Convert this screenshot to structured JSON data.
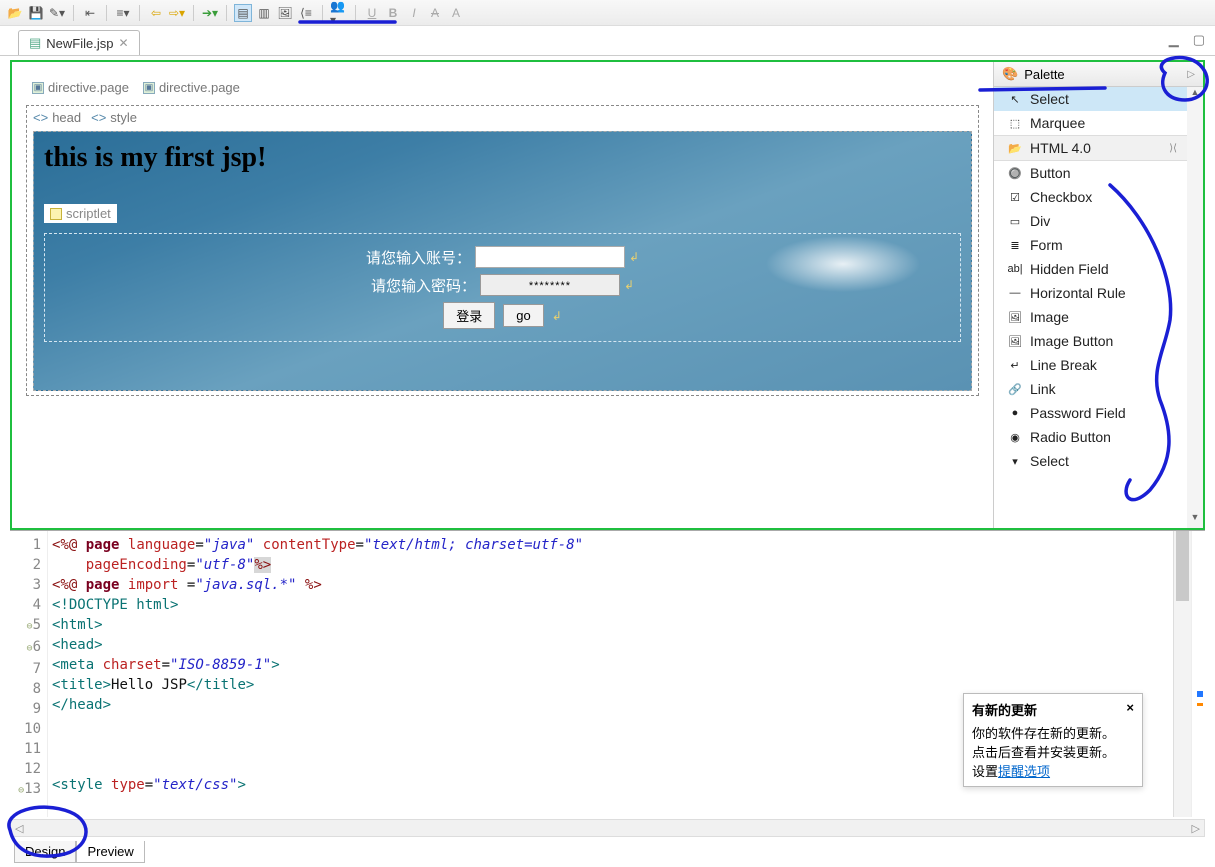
{
  "toolbar": {
    "icons": [
      "open-folder",
      "save",
      "wand",
      "sep",
      "outdent",
      "sep",
      "align",
      "sep",
      "back",
      "fwd",
      "sep",
      "next",
      "sep",
      "split-h",
      "split-v",
      "image",
      "code",
      "sep",
      "people",
      "sep",
      "underline",
      "bold",
      "italic",
      "strike",
      "font"
    ]
  },
  "tab": {
    "filename": "NewFile.jsp",
    "close": "✕"
  },
  "design": {
    "directive1": "directive.page",
    "directive2": "directive.page",
    "head": "head",
    "style": "style",
    "title": "this is my first jsp!",
    "scriptlet": "scriptlet",
    "label_account": "请您输入账号：",
    "label_password": "请您输入密码：",
    "pwd_placeholder": "********",
    "btn_login": "登录",
    "btn_go": "go"
  },
  "palette": {
    "title": "Palette",
    "items_top": [
      {
        "icon": "cursor",
        "label": "Select",
        "sel": true
      },
      {
        "icon": "marquee",
        "label": "Marquee"
      }
    ],
    "group": "HTML 4.0",
    "items": [
      {
        "icon": "btn",
        "label": "Button"
      },
      {
        "icon": "chk",
        "label": "Checkbox"
      },
      {
        "icon": "div",
        "label": "Div"
      },
      {
        "icon": "form",
        "label": "Form"
      },
      {
        "icon": "hid",
        "label": "Hidden Field"
      },
      {
        "icon": "hr",
        "label": "Horizontal Rule"
      },
      {
        "icon": "img",
        "label": "Image"
      },
      {
        "icon": "imgb",
        "label": "Image Button"
      },
      {
        "icon": "br",
        "label": "Line Break"
      },
      {
        "icon": "link",
        "label": "Link"
      },
      {
        "icon": "pwd",
        "label": "Password Field"
      },
      {
        "icon": "radio",
        "label": "Radio Button"
      },
      {
        "icon": "sel",
        "label": "Select"
      }
    ]
  },
  "code": {
    "lines": [
      {
        "n": "1",
        "fold": "",
        "html": "<span class='c-dir'>&lt;%@</span> <span class='c-kw'>page</span> <span class='c-attr'>language</span>=<span class='c-str'>\"java\"</span> <span class='c-attr'>contentType</span>=<span class='c-str'>\"text/html; charset=utf-8\"</span>"
      },
      {
        "n": "2",
        "fold": "",
        "html": "    <span class='c-attr'>pageEncoding</span>=<span class='c-str'>\"utf-8\"</span><span class='sel'><span class='c-dir'>%&gt;</span></span>"
      },
      {
        "n": "3",
        "fold": "",
        "html": "<span class='c-dir'>&lt;%@</span> <span class='c-kw'>page</span> <span class='c-attr'>import</span> =<span class='c-str'>\"java.sql.*\"</span> <span class='c-dir'>%&gt;</span>"
      },
      {
        "n": "4",
        "fold": "",
        "html": "<span class='c-tag'>&lt;!DOCTYPE html&gt;</span>"
      },
      {
        "n": "5",
        "fold": "⊖",
        "html": "<span class='c-tag'>&lt;html&gt;</span>"
      },
      {
        "n": "6",
        "fold": "⊖",
        "html": "<span class='c-tag'>&lt;head&gt;</span>"
      },
      {
        "n": "7",
        "fold": "",
        "html": "<span class='c-tag'>&lt;meta</span> <span class='c-attr'>charset</span>=<span class='c-str'>\"ISO-8859-1\"</span><span class='c-tag'>&gt;</span>"
      },
      {
        "n": "8",
        "fold": "",
        "html": "<span class='c-tag'>&lt;title&gt;</span>Hello JSP<span class='c-tag'>&lt;/title&gt;</span>"
      },
      {
        "n": "9",
        "fold": "",
        "html": "<span class='c-tag'>&lt;/head&gt;</span>"
      },
      {
        "n": "10",
        "fold": "",
        "html": ""
      },
      {
        "n": "11",
        "fold": "",
        "html": ""
      },
      {
        "n": "12",
        "fold": "",
        "html": ""
      },
      {
        "n": "13",
        "fold": "⊖",
        "html": "<span class='c-tag'>&lt;style</span> <span class='c-attr'>type</span>=<span class='c-str'>\"text/css\"</span><span class='c-tag'>&gt;</span>"
      }
    ]
  },
  "notif": {
    "title": "有新的更新",
    "close": "×",
    "line1": "你的软件存在新的更新。",
    "line2": "点击后查看并安装更新。",
    "line3_pre": "设置",
    "line3_link": "提醒选项"
  },
  "bottom_tabs": {
    "design": "Design",
    "preview": "Preview"
  }
}
